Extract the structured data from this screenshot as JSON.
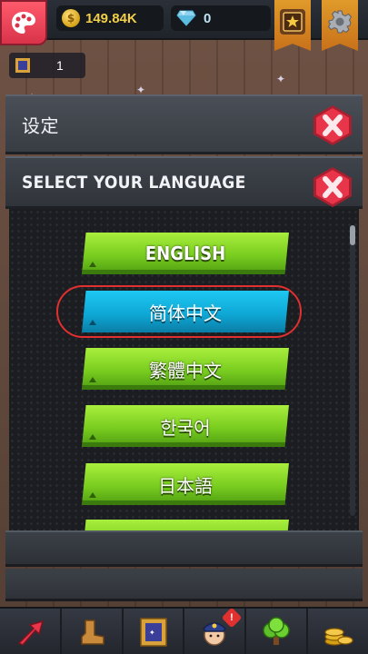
{
  "topbar": {
    "coins": "149.84K",
    "gems": "0",
    "quest_count": "1"
  },
  "settings": {
    "title": "设定"
  },
  "language_panel": {
    "title": "SELECT YOUR LANGUAGE",
    "selected_index": 1,
    "options": [
      {
        "label": "ENGLISH"
      },
      {
        "label": "简体中文"
      },
      {
        "label": "繁體中文"
      },
      {
        "label": "한국어"
      },
      {
        "label": "日本語"
      }
    ]
  },
  "bottom_nav": {
    "tabs": [
      {
        "icon": "upgrade-arrow-icon"
      },
      {
        "icon": "boot-icon"
      },
      {
        "icon": "portrait-frame-icon"
      },
      {
        "icon": "police-character-icon",
        "badge": "!"
      },
      {
        "icon": "tree-icon"
      },
      {
        "icon": "coins-stack-icon"
      }
    ]
  },
  "colors": {
    "accent_green": "#79cd1f",
    "selected_blue": "#0fa8d6",
    "close_red": "#e8354a",
    "coin_gold": "#f2cf4a",
    "highlight_ring": "#e0302f"
  }
}
